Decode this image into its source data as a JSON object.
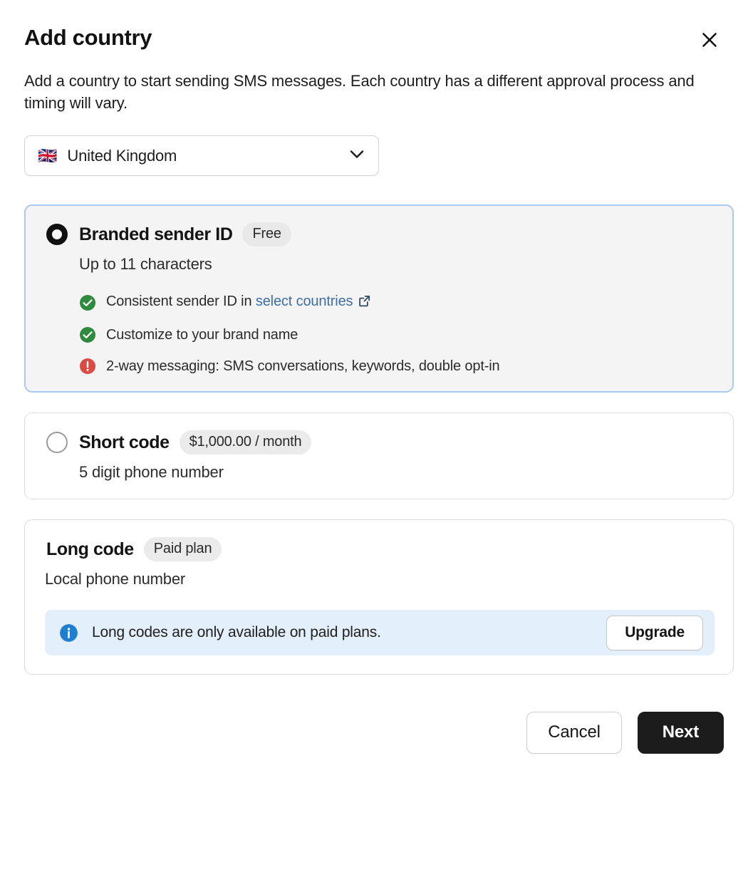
{
  "dialog": {
    "title": "Add country",
    "close_label": "close-icon",
    "description": "Add a country to start sending SMS messages. Each country has a different approval process and timing will vary."
  },
  "country_select": {
    "flag": "🇬🇧",
    "value": "United Kingdom",
    "chevron": "chevron-down-icon"
  },
  "options": [
    {
      "name": "Branded sender ID",
      "badge": "Free",
      "subtitle": "Up to 11 characters",
      "selected": true,
      "features": [
        {
          "status": "ok",
          "text": "Consistent sender ID in ",
          "link": "select countries",
          "has_external_link": true
        },
        {
          "status": "ok",
          "text": "Customize to your brand name",
          "link": "",
          "has_external_link": false
        },
        {
          "status": "warn",
          "text": "2-way messaging: SMS conversations, keywords, double opt-in",
          "link": "",
          "has_external_link": false
        }
      ]
    },
    {
      "name": "Short code",
      "badge": "$1,000.00 / month",
      "subtitle": "5 digit phone number",
      "selected": false
    },
    {
      "name": "Long code",
      "badge": "Paid plan",
      "subtitle": "Local phone number",
      "selected": false,
      "banner": {
        "icon": "info-icon",
        "text": "Long codes are only available on paid plans.",
        "button": "Upgrade"
      }
    }
  ],
  "footer": {
    "cancel": "Cancel",
    "next": "Next"
  },
  "colors": {
    "accent_border": "#a9c9ee",
    "selected_bg": "#f4f4f4",
    "success": "#2e8b3d",
    "warning": "#d94b45",
    "info": "#1f7ed0",
    "banner_bg": "#e3f0fb",
    "link": "#3d6fa5",
    "primary_button": "#1c1c1c"
  }
}
